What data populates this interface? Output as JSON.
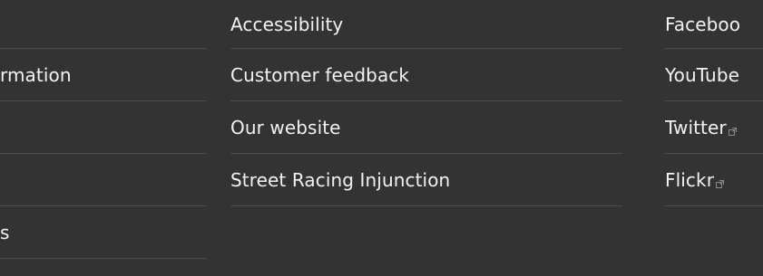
{
  "left_column": {
    "items": [
      {
        "label": ""
      },
      {
        "label": "rmation"
      },
      {
        "label": ""
      },
      {
        "label": ""
      },
      {
        "label": "s"
      }
    ]
  },
  "middle_column": {
    "items": [
      {
        "label": "Accessibility"
      },
      {
        "label": "Customer feedback"
      },
      {
        "label": "Our website"
      },
      {
        "label": "Street Racing Injunction"
      }
    ]
  },
  "right_column": {
    "items": [
      {
        "label": "Faceboo",
        "icon": ""
      },
      {
        "label": "YouTube",
        "icon": ""
      },
      {
        "label": "Twitter",
        "icon": "external-link-icon"
      },
      {
        "label": "Flickr",
        "icon": "external-link-icon"
      }
    ]
  },
  "colors": {
    "background": "#333333",
    "text": "#f2f2f2",
    "divider": "#4d4d4d"
  }
}
